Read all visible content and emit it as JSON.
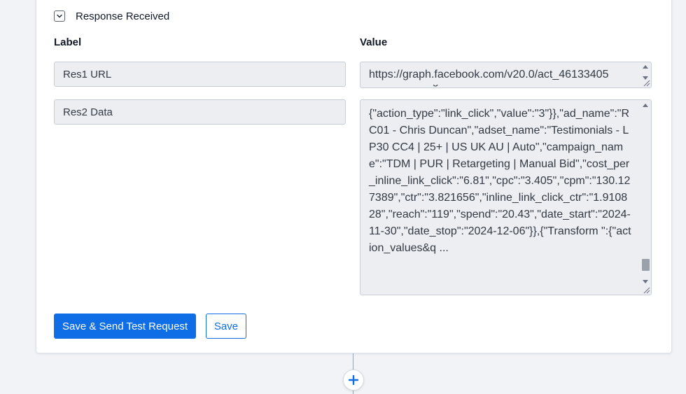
{
  "section": {
    "title": "Response Received",
    "toggle_icon": "chevron-down-icon"
  },
  "columns": {
    "label": "Label",
    "value": "Value"
  },
  "rows": [
    {
      "label": "Res1 URL",
      "value": "https://graph.facebook.com/v20.0/act_46133405"
    },
    {
      "label": "Res2 Data",
      "value": "{\"action_type\":\"link_click\",\"value\":\"3\"}},\"ad_name\":\"RC01 - Chris Duncan\",\"adset_name\":\"Testimonials - LP30 CC4 | 25+ | US UK AU | Auto\",\"campaign_name\":\"TDM | PUR | Retargeting | Manual Bid\",\"cost_per_inline_link_click\":\"6.81\",\"cpc\":\"3.405\",\"cpm\":\"130.127389\",\"ctr\":\"3.821656\",\"inline_link_click_ctr\":\"1.910828\",\"reach\":\"119\",\"spend\":\"20.43\",\"date_start\":\"2024-11-30\",\"date_stop\":\"2024-12-06\"}},{\"Transform \":{\"action_values&q ..."
    }
  ],
  "buttons": {
    "save_send": "Save & Send Test Request",
    "save": "Save"
  },
  "add_step": {
    "icon": "plus-icon"
  },
  "colors": {
    "accent": "#0f6de6",
    "field_bg": "#eceef1",
    "page_bg": "#f1f3f6"
  }
}
